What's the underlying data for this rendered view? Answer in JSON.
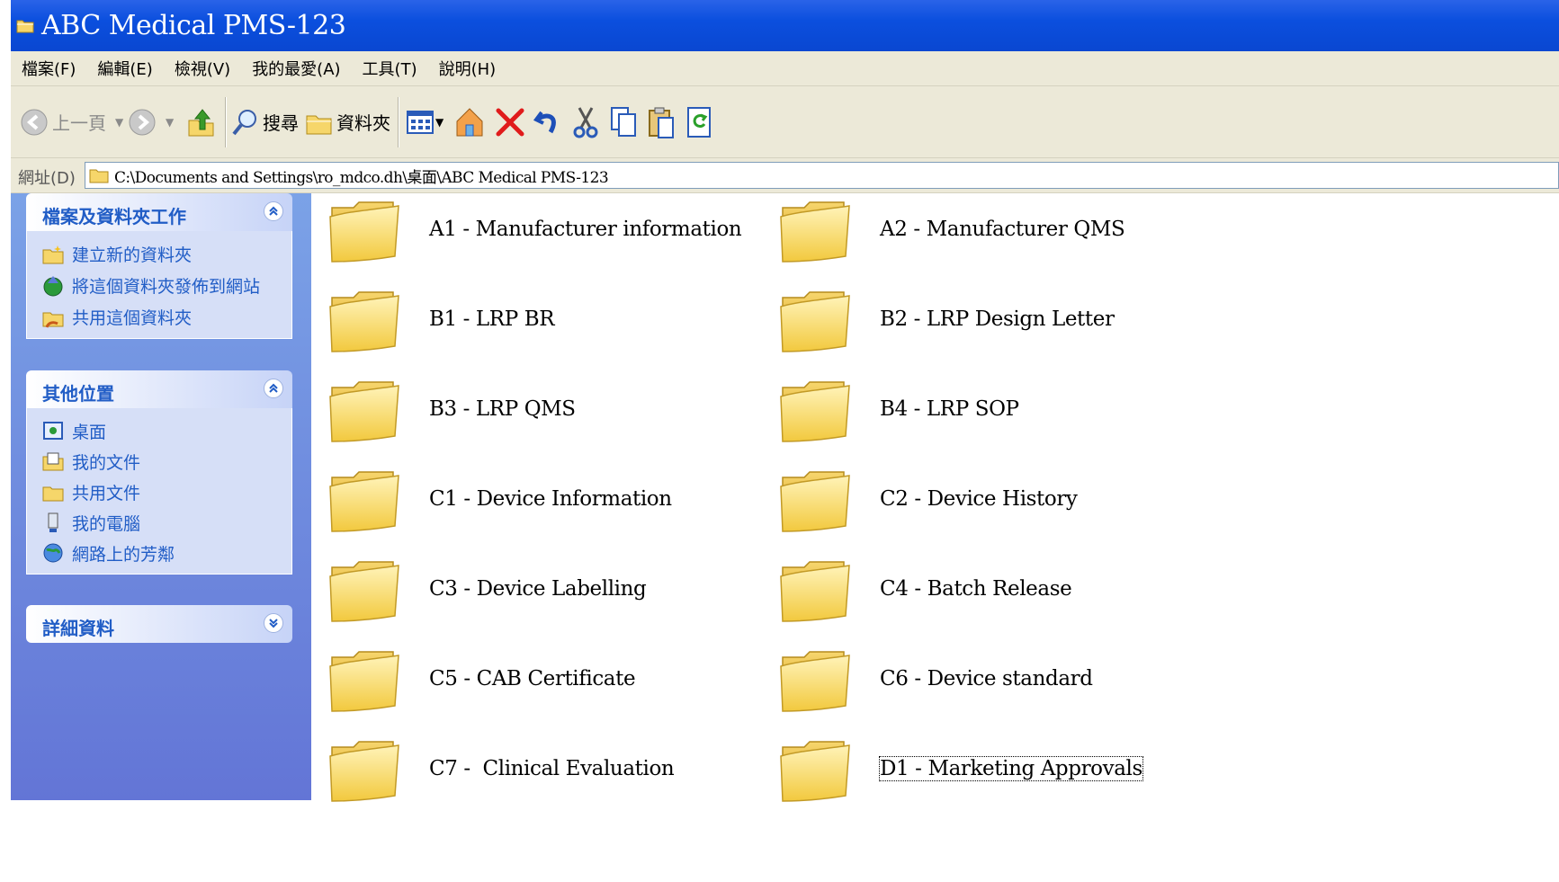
{
  "window": {
    "title": "ABC Medical PMS-123",
    "icon": "folder-icon"
  },
  "menu": [
    {
      "label": "檔案(F)"
    },
    {
      "label": "編輯(E)"
    },
    {
      "label": "檢視(V)"
    },
    {
      "label": "我的最愛(A)"
    },
    {
      "label": "工具(T)"
    },
    {
      "label": "說明(H)"
    }
  ],
  "toolbar": {
    "back_label": "上一頁",
    "search_label": "搜尋",
    "folders_label": "資料夾",
    "icons": [
      "back-arrow-icon",
      "forward-arrow-icon",
      "up-folder-icon",
      "search-icon",
      "folders-icon",
      "views-icon",
      "home-icon",
      "delete-icon",
      "undo-icon",
      "cut-icon",
      "copy-icon",
      "paste-icon",
      "refresh-icon"
    ]
  },
  "address": {
    "label": "網址(D)",
    "path": "C:\\Documents and Settings\\ro_mdco.dh\\桌面\\ABC Medical PMS-123"
  },
  "taskpane": {
    "file_tasks": {
      "title": "檔案及資料夾工作",
      "items": [
        {
          "label": "建立新的資料夾",
          "icon": "new-folder-icon"
        },
        {
          "label": "將這個資料夾發佈到網站",
          "icon": "publish-web-icon"
        },
        {
          "label": "共用這個資料夾",
          "icon": "share-folder-icon"
        }
      ]
    },
    "other_places": {
      "title": "其他位置",
      "items": [
        {
          "label": "桌面",
          "icon": "desktop-icon"
        },
        {
          "label": "我的文件",
          "icon": "my-documents-icon"
        },
        {
          "label": "共用文件",
          "icon": "shared-documents-icon"
        },
        {
          "label": "我的電腦",
          "icon": "my-computer-icon"
        },
        {
          "label": "網路上的芳鄰",
          "icon": "network-places-icon"
        }
      ]
    },
    "details": {
      "title": "詳細資料"
    }
  },
  "folders": [
    {
      "name": "A1 - Manufacturer information"
    },
    {
      "name": "A2 - Manufacturer QMS"
    },
    {
      "name": "B1 - LRP BR"
    },
    {
      "name": "B2 - LRP Design Letter"
    },
    {
      "name": "B3 - LRP QMS"
    },
    {
      "name": "B4 - LRP SOP"
    },
    {
      "name": "C1 - Device Information"
    },
    {
      "name": "C2 - Device History"
    },
    {
      "name": "C3 - Device Labelling"
    },
    {
      "name": "C4 - Batch Release"
    },
    {
      "name": "C5 - CAB Certificate"
    },
    {
      "name": "C6 - Device standard"
    },
    {
      "name": "C7 -  Clinical Evaluation"
    },
    {
      "name": "D1 - Marketing Approvals",
      "selected": true
    }
  ]
}
